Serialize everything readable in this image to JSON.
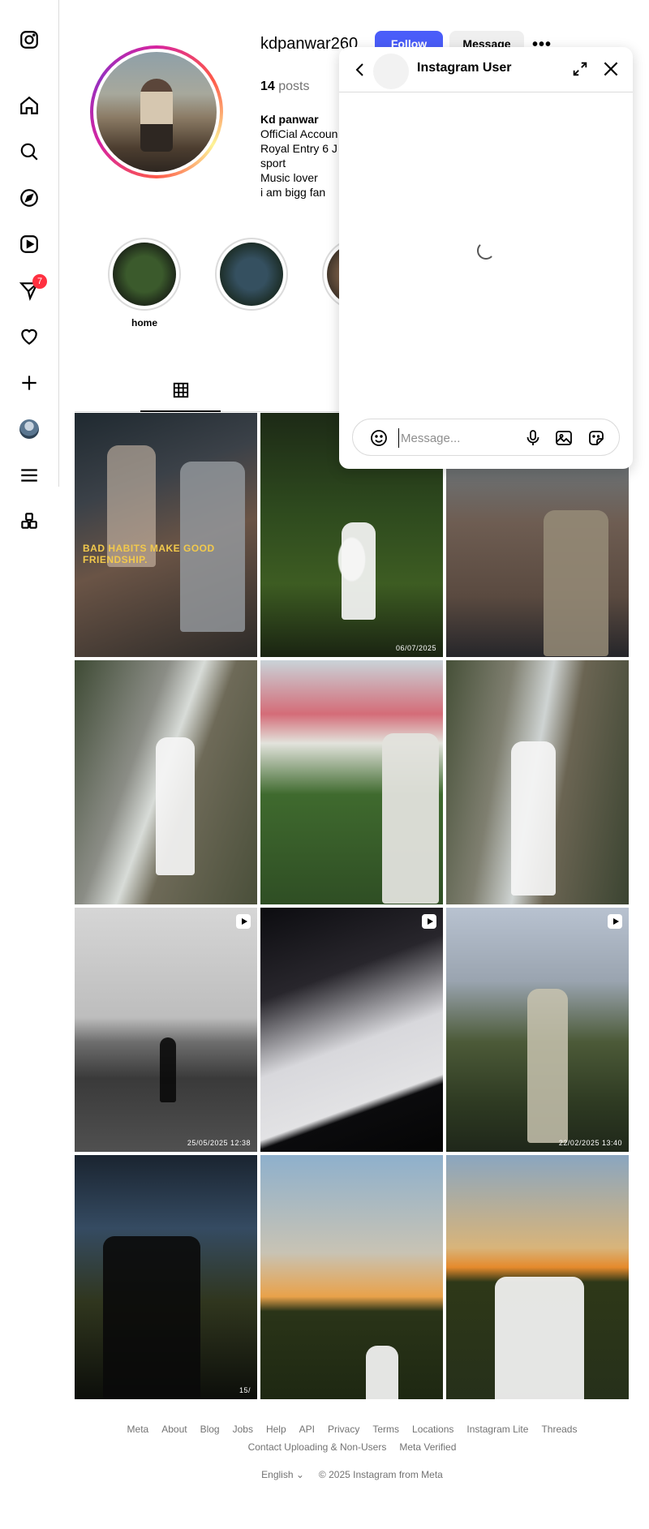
{
  "nav": {
    "notification_count": "7"
  },
  "profile": {
    "username": "kdpanwar260",
    "follow_label": "Follow",
    "message_label": "Message",
    "more_label": "•••",
    "posts_count": "14",
    "posts_label": "posts",
    "name": "Kd panwar",
    "bio": [
      "OffiCial Accoun",
      "Royal Entry 6 J",
      "sport ",
      " Music lover ",
      "i am bigg fan"
    ]
  },
  "highlights": [
    {
      "label": "home"
    },
    {
      "label": ""
    },
    {
      "label": ""
    }
  ],
  "grid": {
    "tiles": [
      {
        "caption": "BAD HABITS MAKE GOOD FRIENDSHIP.",
        "stamp": "",
        "reel": false
      },
      {
        "caption": "",
        "stamp": "06/07/2025",
        "reel": false
      },
      {
        "caption": "",
        "stamp": "",
        "reel": false
      },
      {
        "caption": "",
        "stamp": "",
        "reel": false
      },
      {
        "caption": "",
        "stamp": "",
        "reel": false
      },
      {
        "caption": "",
        "stamp": "",
        "reel": false
      },
      {
        "caption": "",
        "stamp": "25/05/2025 12:38",
        "reel": true
      },
      {
        "caption": "",
        "stamp": "",
        "reel": true
      },
      {
        "caption": "",
        "stamp": "22/02/2025 13:40",
        "reel": true
      },
      {
        "caption": "",
        "stamp": "15/",
        "reel": false
      },
      {
        "caption": "",
        "stamp": "",
        "reel": false
      },
      {
        "caption": "",
        "stamp": "",
        "reel": false
      }
    ]
  },
  "footer": {
    "links": [
      "Meta",
      "About",
      "Blog",
      "Jobs",
      "Help",
      "API",
      "Privacy",
      "Terms",
      "Locations",
      "Instagram Lite",
      "Threads",
      "Contact Uploading & Non-Users",
      "Meta Verified"
    ],
    "language": "English",
    "copyright": "© 2025 Instagram from Meta"
  },
  "chat": {
    "title": "Instagram User",
    "placeholder": "Message..."
  },
  "colors": {
    "follow_blue": "#4a5df9",
    "badge_red": "#ff3040"
  }
}
